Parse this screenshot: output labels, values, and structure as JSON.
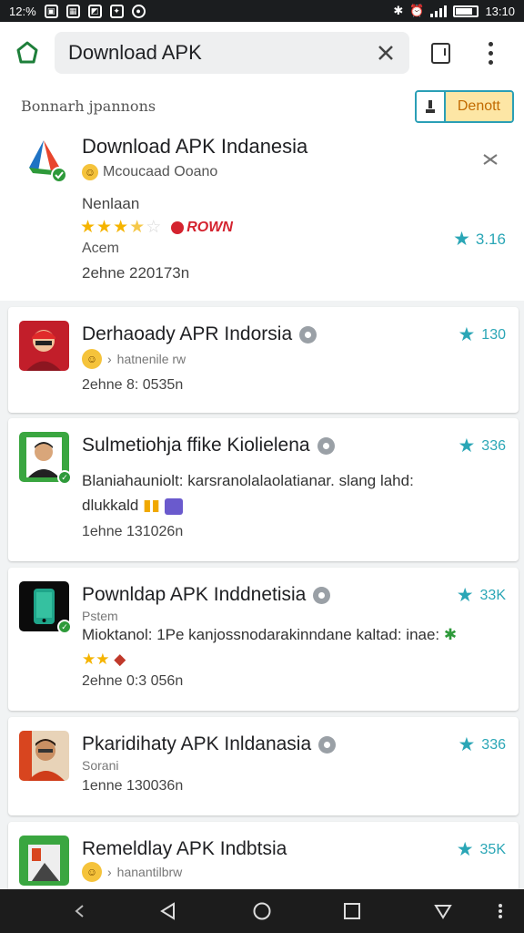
{
  "status_bar": {
    "time_left": "12:%",
    "time_right": "13:10",
    "left_icons": [
      "photo-icon",
      "gallery-icon",
      "image-icon",
      "notification-icon",
      "vpn-icon"
    ],
    "right_icons": [
      "bluetooth-icon",
      "alarm-icon",
      "signal-icon",
      "battery-icon"
    ]
  },
  "app_bar": {
    "search_text": "Download APK"
  },
  "results_header": {
    "title": "Bonnarh jpannons",
    "deposit_label": "Denott"
  },
  "featured": {
    "title": "Download APK Indanesia",
    "developer": "Mcoucaad Ooano",
    "category": "Nenlaan",
    "rating_stars": 3.5,
    "badge": "ROWN",
    "label": "Acem",
    "size": "2ehne 220173n",
    "rating": "3.16"
  },
  "results": [
    {
      "title": "Derhaoady APR Indorsia",
      "sub": "hatnenile rw",
      "size": "2ehne 8: 0535n",
      "rating": "130"
    },
    {
      "title": "Sulmetiohja ffike Kiolielena",
      "desc": "Blaniahauniolt: karsranolalaolatianar. slang lahd: dlukkald",
      "size": "1ehne 131026n",
      "rating": "336"
    },
    {
      "title": "Pownldap APK Inddnetisia",
      "sub": "Pstem",
      "desc": "Mioktanol: 1Pe kanjossnodarakinndane kaltad: inae:",
      "size": "2ehne 0:3 056n",
      "rating": "33K"
    },
    {
      "title": "Pkaridihaty APK Inldanasia",
      "sub": "Sorani",
      "size": "1enne 130036n",
      "rating": "336"
    },
    {
      "title": "Remeldlay APK Indbtsia",
      "sub": "hanantilbrw",
      "rating": "35K"
    }
  ],
  "colors": {
    "accent": "#2aa6b6",
    "star": "#f5b400",
    "badge_red": "#d4232f",
    "nav_bar": "#1c1c1c"
  }
}
